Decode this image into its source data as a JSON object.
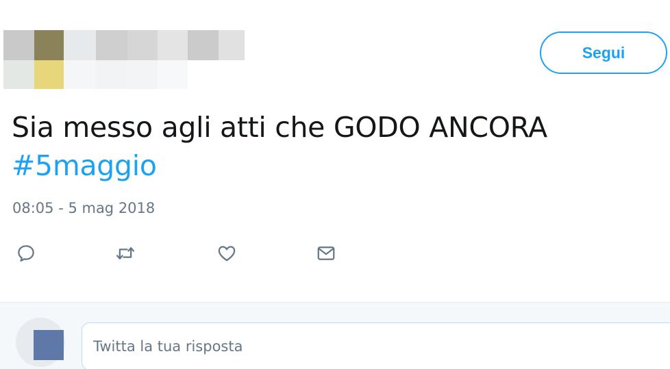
{
  "tweet": {
    "text": "Sia messo agli atti che GODO ANCORA",
    "hashtag": "#5maggio",
    "timestamp": "08:05 - 5 mag 2018"
  },
  "header": {
    "follow_label": "Segui",
    "author_redacted": true
  },
  "actions": [
    {
      "name": "reply",
      "icon": "reply-icon"
    },
    {
      "name": "retweet",
      "icon": "retweet-icon"
    },
    {
      "name": "like",
      "icon": "heart-icon"
    },
    {
      "name": "direct-message",
      "icon": "envelope-icon"
    }
  ],
  "reply": {
    "placeholder": "Twitta la tua risposta"
  },
  "colors": {
    "accent": "#1da1f2",
    "text": "#14171a",
    "muted": "#657786",
    "reply_bg": "#f5f8fa"
  }
}
